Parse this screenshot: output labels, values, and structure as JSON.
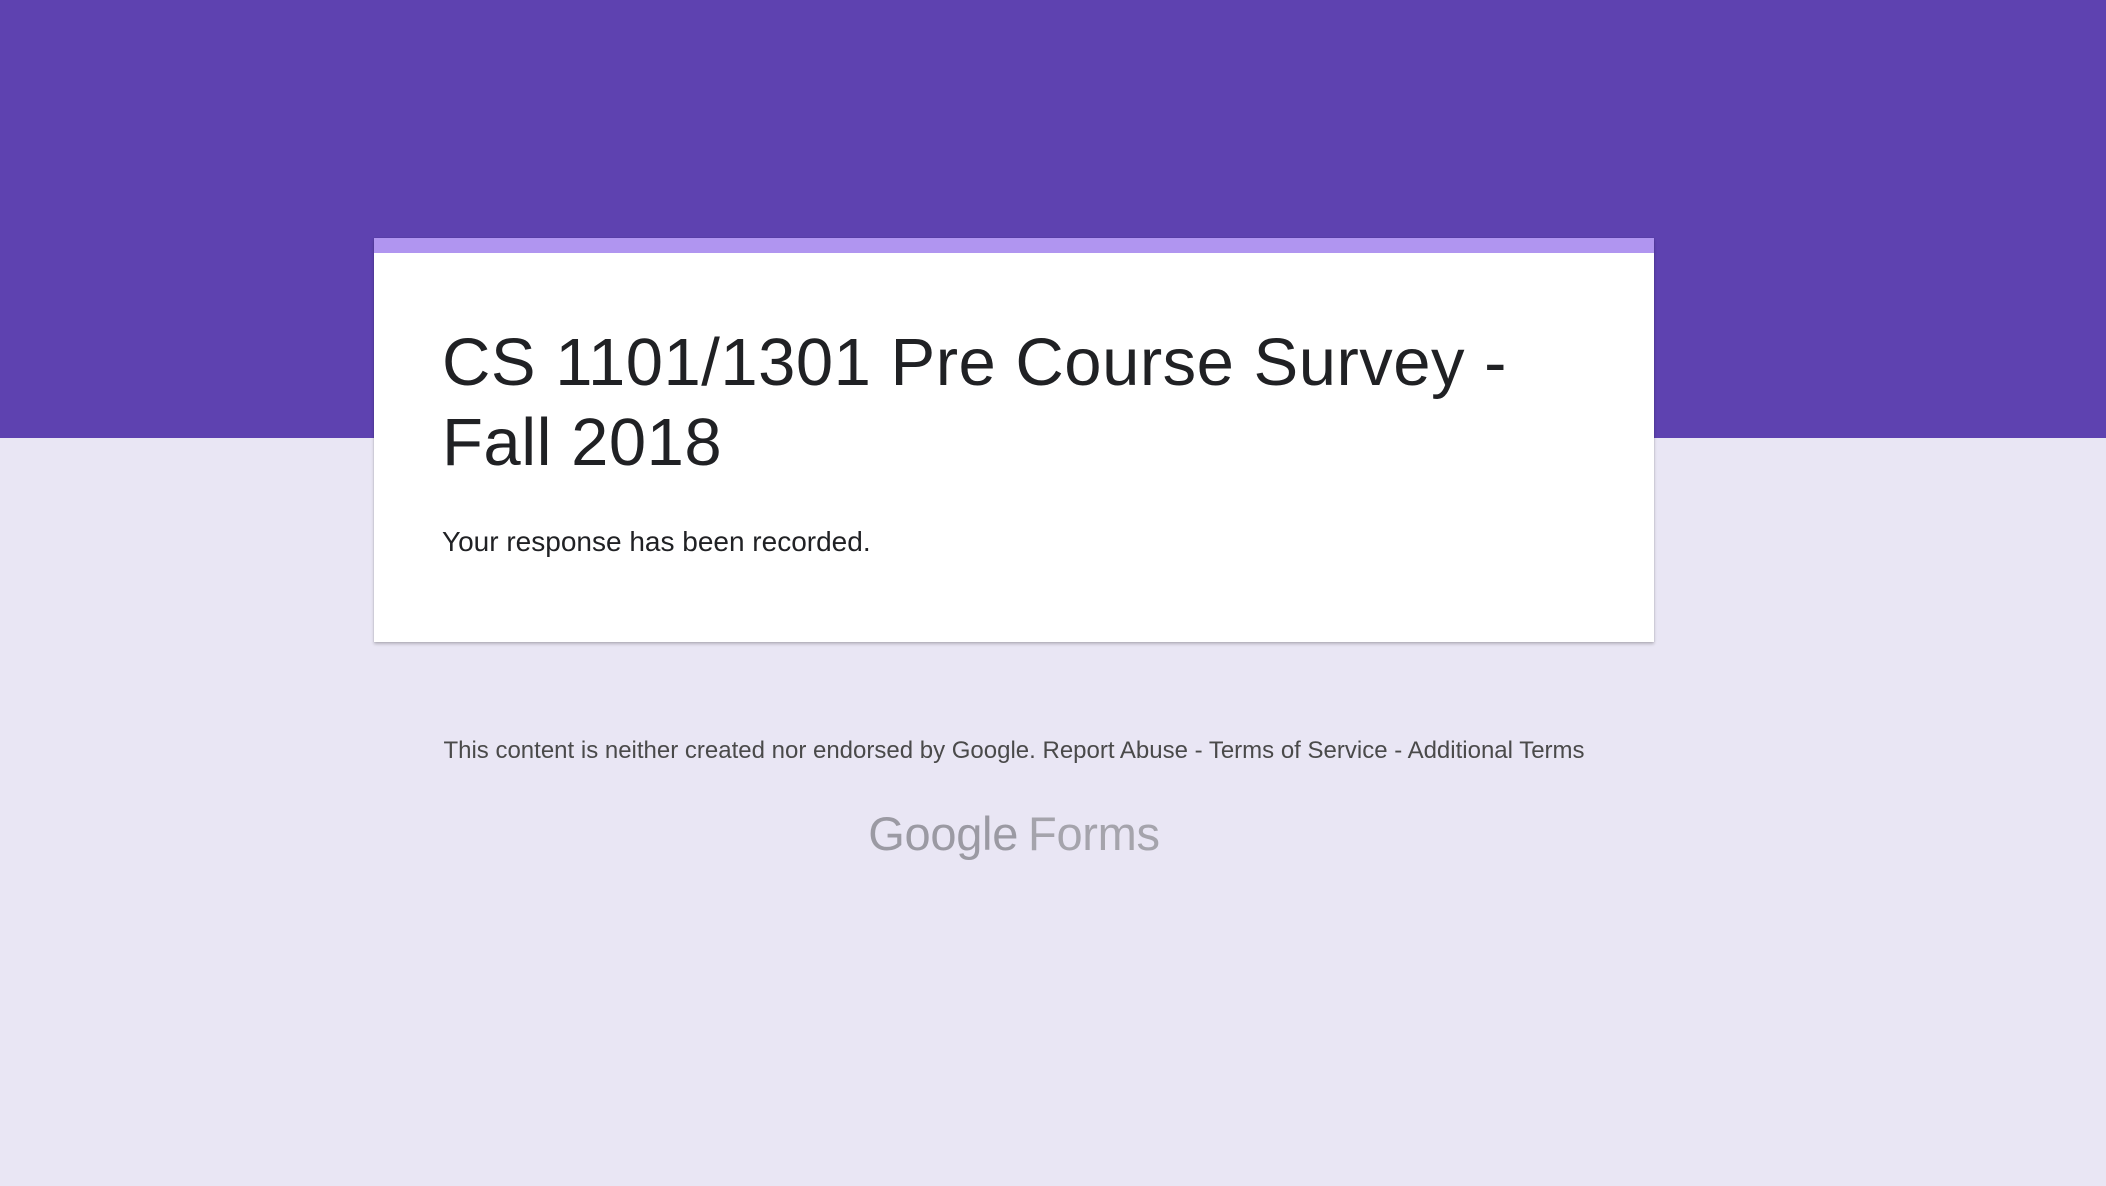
{
  "header": {
    "background_color": "#5e42b0",
    "accent_color": "#b095f0",
    "page_background_color": "#e9e6f4"
  },
  "form": {
    "title": "CS 1101/1301 Pre Course Survey - Fall 2018",
    "confirmation_message": "Your response has been recorded."
  },
  "footer": {
    "disclaimer": "This content is neither created nor endorsed by Google.",
    "links": {
      "report_abuse": "Report Abuse",
      "separator_1": " - ",
      "terms_of_service": "Terms of Service",
      "separator_2": " - ",
      "additional_terms": "Additional Terms"
    }
  },
  "logo": {
    "brand": "Google",
    "product": "Forms"
  }
}
